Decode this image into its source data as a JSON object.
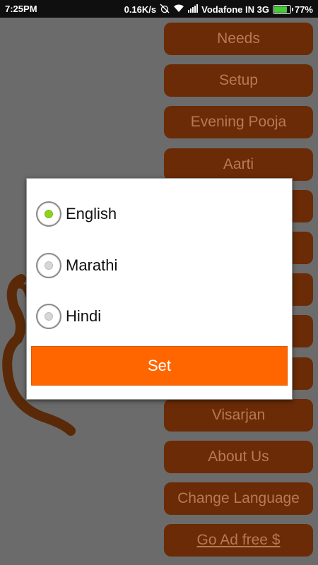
{
  "status_bar": {
    "time": "7:25PM",
    "speed": "0.16K/s",
    "carrier": "Vodafone IN 3G",
    "battery": "77%",
    "battery_level": 0.77,
    "icons": [
      "alarm-off-icon",
      "wifi-icon",
      "signal-icon",
      "battery-icon"
    ]
  },
  "menu": {
    "items": [
      {
        "label": "Needs"
      },
      {
        "label": "Setup"
      },
      {
        "label": "Evening Pooja"
      },
      {
        "label": "Aarti"
      },
      {
        "label": ""
      },
      {
        "label": ""
      },
      {
        "label": ""
      },
      {
        "label": ""
      },
      {
        "label": ""
      },
      {
        "label": "Visarjan"
      },
      {
        "label": "About Us"
      },
      {
        "label": "Change Language"
      },
      {
        "label": "Go Ad free $"
      }
    ]
  },
  "dialog": {
    "options": [
      {
        "label": "English",
        "selected": true
      },
      {
        "label": "Marathi",
        "selected": false
      },
      {
        "label": "Hindi",
        "selected": false
      }
    ],
    "set_label": "Set"
  },
  "colors": {
    "menu_button": "#6a2b06",
    "menu_text": "#b77a52",
    "set_button": "#ff6600",
    "radio_selected": "#8fd21b"
  }
}
